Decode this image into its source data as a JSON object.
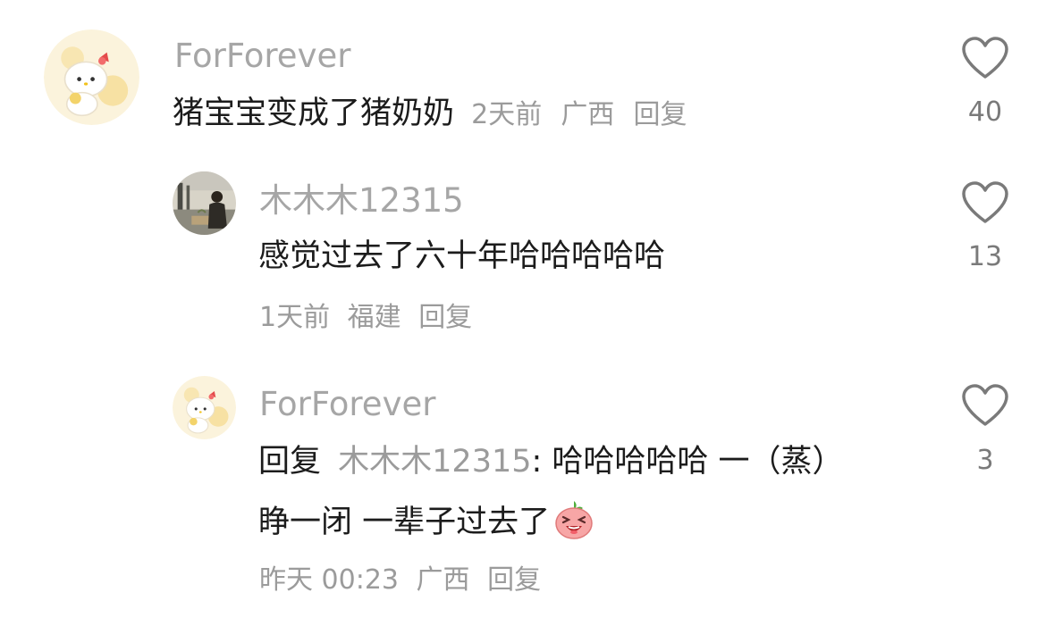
{
  "comments": [
    {
      "username": "ForForever",
      "text": "猪宝宝变成了猪奶奶",
      "time": "2天前",
      "location": "广西",
      "reply_label": "回复",
      "likes": "40",
      "avatar_icon": "hello-kitty-avatar-icon"
    },
    {
      "username": "木木木12315",
      "text": "感觉过去了六十年哈哈哈哈哈",
      "time": "1天前",
      "location": "福建",
      "reply_label": "回复",
      "likes": "13",
      "avatar_icon": "person-photo-avatar-icon"
    },
    {
      "username": "ForForever",
      "reply_prefix": "回复",
      "mention": "木木木12315",
      "text_line1": ": 哈哈哈哈哈 一（蒸）",
      "text_line2": "睁一闭 一辈子过去了",
      "emoji_icon": "laughing-peach-emoji-icon",
      "time": "昨天 00:23",
      "location": "广西",
      "reply_label": "回复",
      "likes": "3",
      "avatar_icon": "hello-kitty-avatar-icon"
    }
  ],
  "colors": {
    "username": "#a6a6a6",
    "text": "#1c1c1c",
    "meta": "#9b9b9b",
    "heart": "#7a7a7a"
  }
}
